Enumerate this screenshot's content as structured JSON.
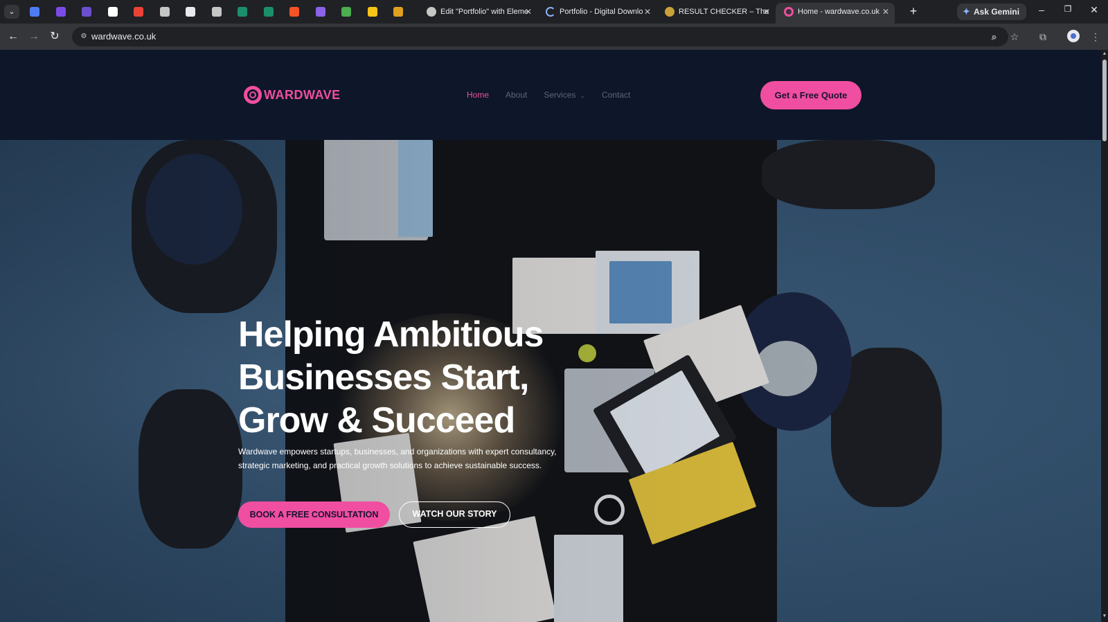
{
  "browser": {
    "tab_search_icon": "chevron-down-icon",
    "pinned_tabs": [
      {
        "icon": "check-shield-icon",
        "color": "#4e7bf5"
      },
      {
        "icon": "h-logo-icon",
        "color": "#7b4be8"
      },
      {
        "icon": "hat-icon",
        "color": "#6a4fcf"
      },
      {
        "icon": "openai-icon",
        "color": "#ffffff"
      },
      {
        "icon": "gmail-icon",
        "color": "#ea4335"
      },
      {
        "icon": "globe-icon",
        "color": "#c4c7c5"
      },
      {
        "icon": "document-icon",
        "color": "#e8eaed"
      },
      {
        "icon": "globe-icon",
        "color": "#c4c7c5"
      },
      {
        "icon": "check-badge-icon",
        "color": "#1b8f6a"
      },
      {
        "icon": "check-badge-icon",
        "color": "#1b8f6a"
      },
      {
        "icon": "microsoft-icon",
        "color": "#f35325"
      },
      {
        "icon": "qr-icon",
        "color": "#8a63e8"
      },
      {
        "icon": "stripes-icon",
        "color": "#4caf50"
      },
      {
        "icon": "card-icon",
        "color": "#f5c518"
      },
      {
        "icon": "bee-icon",
        "color": "#e0a020"
      }
    ],
    "tabs": [
      {
        "title": "Edit \"Portfolio\" with Eleme",
        "icon": "globe-icon",
        "active": false
      },
      {
        "title": "Portfolio - Digital Downlo",
        "icon": "loading-icon",
        "active": false
      },
      {
        "title": "RESULT CHECKER – The W",
        "icon": "gear-icon",
        "active": false
      },
      {
        "title": "Home - wardwave.co.uk",
        "icon": "wardwave-icon",
        "active": true
      }
    ],
    "new_tab_label": "+",
    "gemini_label": "Ask Gemini",
    "window_controls": {
      "minimize": "–",
      "restore": "❐",
      "close": "✕"
    },
    "url": "wardwave.co.uk"
  },
  "site": {
    "logo_text": "WARDWAVE",
    "nav": [
      {
        "label": "Home",
        "active": true
      },
      {
        "label": "About",
        "active": false
      },
      {
        "label": "Services",
        "active": false,
        "dropdown": true
      },
      {
        "label": "Contact",
        "active": false
      }
    ],
    "quote_button": "Get a Free Quote",
    "hero": {
      "title_lines": [
        "Helping Ambitious",
        "Businesses Start,",
        "Grow & Succeed"
      ],
      "subtitle_lines": [
        "Wardwave empowers startups, businesses, and organizations with expert consultancy,",
        "strategic marketing, and practical growth solutions to achieve sustainable success."
      ],
      "primary_button": "BOOK A FREE CONSULTATION",
      "secondary_button": "WATCH OUR STORY"
    },
    "colors": {
      "accent": "#f04ea0",
      "header_bg": "#0e1629",
      "nav_inactive": "#5d6577"
    }
  }
}
